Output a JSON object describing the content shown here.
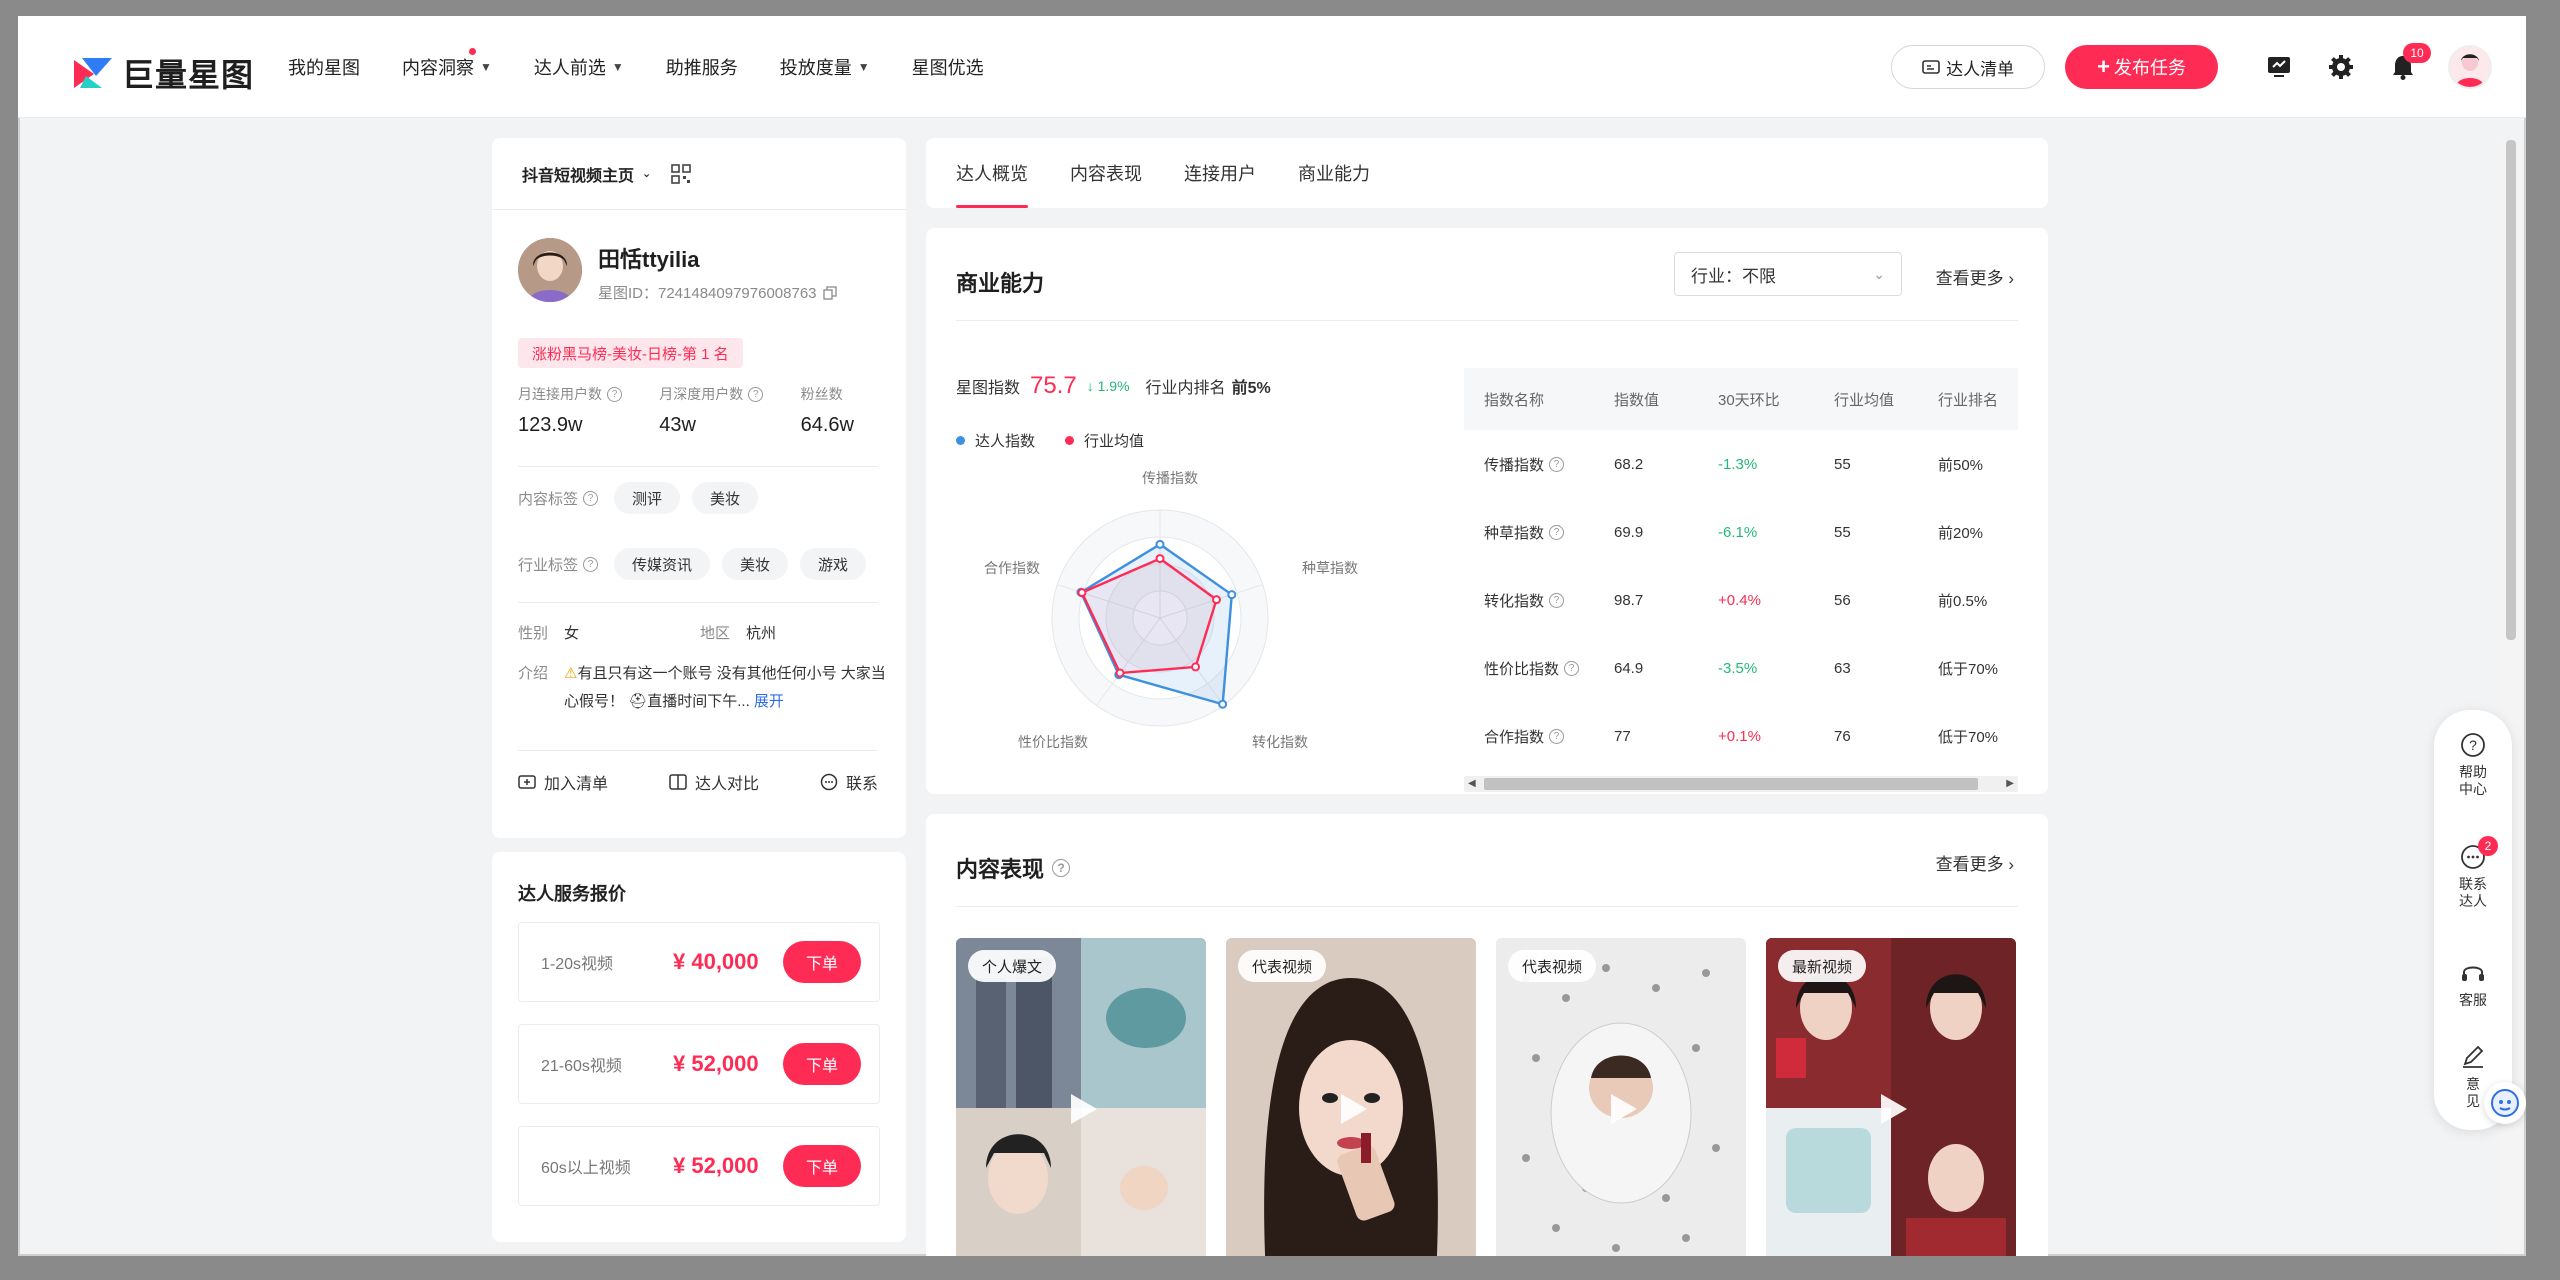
{
  "brand": {
    "name": "巨量星图",
    "accent": "#fe2c55"
  },
  "nav": {
    "items": [
      {
        "label": "我的星图",
        "caret": false,
        "dot": false
      },
      {
        "label": "内容洞察",
        "caret": true,
        "dot": true
      },
      {
        "label": "达人前选",
        "caret": true,
        "dot": false
      },
      {
        "label": "助推服务",
        "caret": false,
        "dot": false
      },
      {
        "label": "投放度量",
        "caret": true,
        "dot": false
      },
      {
        "label": "星图优选",
        "caret": false,
        "dot": false
      }
    ],
    "list_button": "达人清单",
    "publish_button": "发布任务",
    "notification_count": "10"
  },
  "left": {
    "platform_select": "抖音短视频主页",
    "name": "田恬ttyilia",
    "id_text": "星图ID：7241484097976008763",
    "rank_tag": "涨粉黑马榜-美妆-日榜-第 1 名",
    "stats": [
      {
        "label": "月连接用户数",
        "value": "123.9w"
      },
      {
        "label": "月深度用户数",
        "value": "43w"
      },
      {
        "label": "粉丝数",
        "value": "64.6w"
      }
    ],
    "content_tags_label": "内容标签",
    "content_tags": [
      "测评",
      "美妆"
    ],
    "industry_tags_label": "行业标签",
    "industry_tags": [
      "传媒资讯",
      "美妆",
      "游戏"
    ],
    "gender_label": "性别",
    "gender_value": "女",
    "region_label": "地区",
    "region_value": "杭州",
    "intro_label": "介绍",
    "intro_text": "有且只有这一个账号 没有其他任何小号 大家当心假号！",
    "intro_text2": "直播时间下午...",
    "intro_more": "展开",
    "actions": [
      "加入清单",
      "达人对比",
      "联系"
    ]
  },
  "pricing": {
    "title": "达人服务报价",
    "rows": [
      {
        "label": "1-20s视频",
        "price": "¥ 40,000",
        "button": "下单"
      },
      {
        "label": "21-60s视频",
        "price": "¥ 52,000",
        "button": "下单"
      },
      {
        "label": "60s以上视频",
        "price": "¥ 52,000",
        "button": "下单"
      }
    ]
  },
  "tabs": [
    "达人概览",
    "内容表现",
    "连接用户",
    "商业能力"
  ],
  "business": {
    "title": "商业能力",
    "industry_select": "行业：不限",
    "see_more": "查看更多",
    "score_label": "星图指数",
    "score_value": "75.7",
    "score_trend": "↓ 1.9%",
    "rank_label": "行业内排名",
    "rank_value": "前5%",
    "legend": [
      {
        "name": "达人指数",
        "color": "#3d8fe0"
      },
      {
        "name": "行业均值",
        "color": "#fe2c55"
      }
    ],
    "table_headers": [
      "指数名称",
      "指数值",
      "30天环比",
      "行业均值",
      "行业排名"
    ],
    "table_rows": [
      {
        "name": "传播指数",
        "value": "68.2",
        "change": "-1.3%",
        "avg": "55",
        "rank": "前50%"
      },
      {
        "name": "种草指数",
        "value": "69.9",
        "change": "-6.1%",
        "avg": "55",
        "rank": "前20%"
      },
      {
        "name": "转化指数",
        "value": "98.7",
        "change": "+0.4%",
        "avg": "56",
        "rank": "前0.5%"
      },
      {
        "name": "性价比指数",
        "value": "64.9",
        "change": "-3.5%",
        "avg": "63",
        "rank": "低于70%"
      },
      {
        "name": "合作指数",
        "value": "77",
        "change": "+0.1%",
        "avg": "76",
        "rank": "低于70%"
      }
    ]
  },
  "chart_data": {
    "type": "radar",
    "axes": [
      "传播指数",
      "种草指数",
      "转化指数",
      "性价比指数",
      "合作指数"
    ],
    "series": [
      {
        "name": "达人指数",
        "values": [
          68.2,
          69.9,
          98.7,
          64.9,
          77
        ],
        "color": "#3d8fe0"
      },
      {
        "name": "行业均值",
        "values": [
          55,
          55,
          56,
          63,
          76
        ],
        "color": "#fe2c55"
      }
    ],
    "max": 100
  },
  "content": {
    "title": "内容表现",
    "see_more": "查看更多",
    "videos": [
      {
        "tag": "个人爆文"
      },
      {
        "tag": "代表视频"
      },
      {
        "tag": "代表视频"
      },
      {
        "tag": "最新视频"
      }
    ]
  },
  "float": {
    "help": "帮助中心",
    "contact": "联系达人",
    "contact_badge": "2",
    "service": "客服",
    "feedback": "意见反馈"
  }
}
